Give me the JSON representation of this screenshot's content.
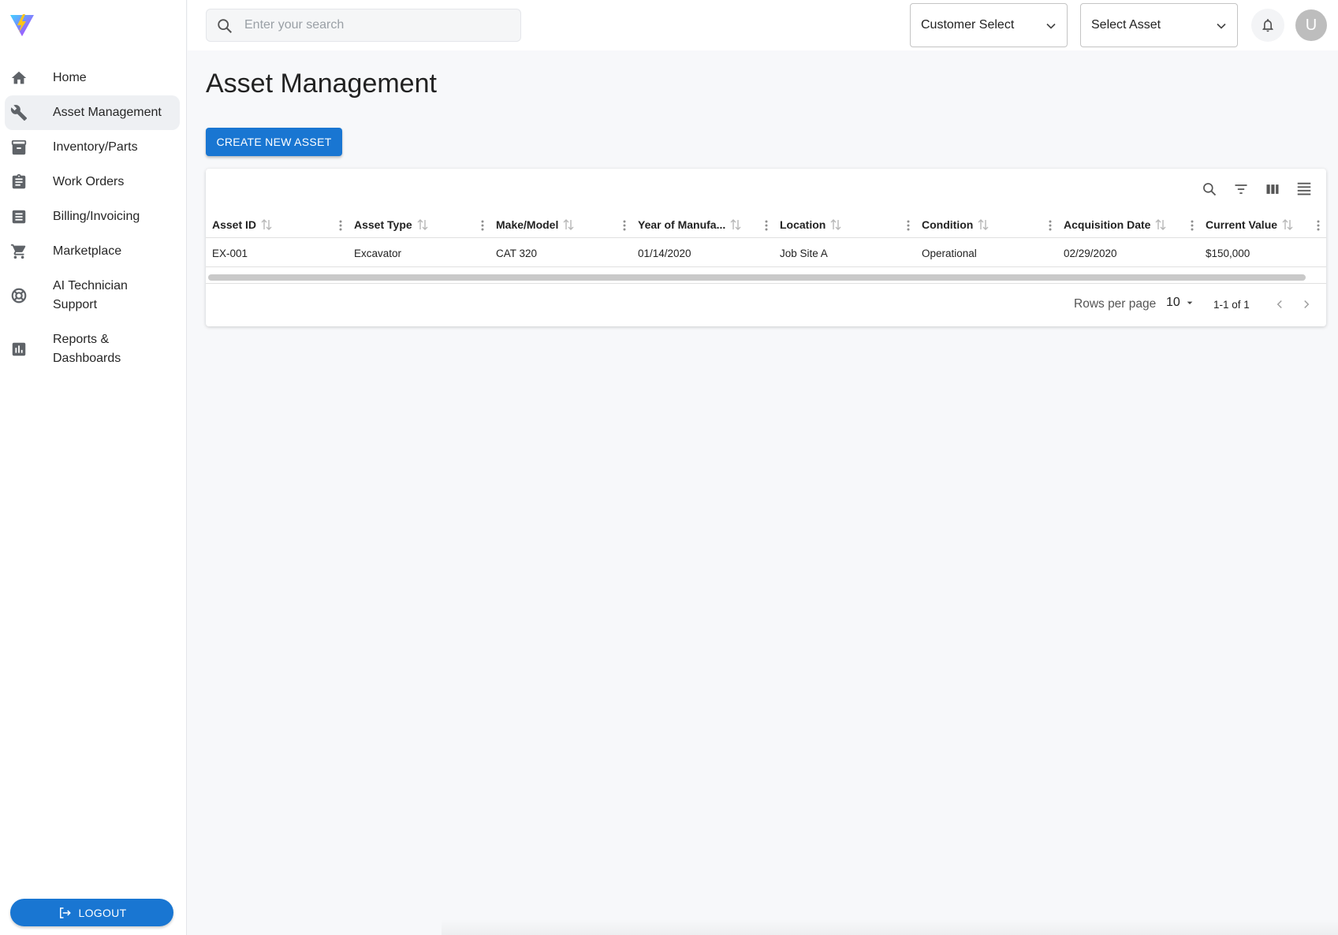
{
  "sidebar": {
    "items": [
      {
        "label": "Home",
        "icon": "home-icon"
      },
      {
        "label": "Asset Management",
        "icon": "wrench-icon",
        "active": true
      },
      {
        "label": "Inventory/Parts",
        "icon": "archive-icon"
      },
      {
        "label": "Work Orders",
        "icon": "clipboard-icon"
      },
      {
        "label": "Billing/Invoicing",
        "icon": "receipt-icon"
      },
      {
        "label": "Marketplace",
        "icon": "cart-icon"
      },
      {
        "label": "AI Technician Support",
        "icon": "lifebuoy-icon"
      },
      {
        "label": "Reports & Dashboards",
        "icon": "bar-chart-icon"
      }
    ],
    "logout_label": "LOGOUT"
  },
  "header": {
    "search_placeholder": "Enter your search",
    "customer_select": "Customer Select",
    "asset_select": "Select Asset",
    "avatar_initial": "U"
  },
  "main": {
    "title": "Asset Management",
    "create_button": "CREATE NEW ASSET"
  },
  "table": {
    "columns": [
      "Asset ID",
      "Asset Type",
      "Make/Model",
      "Year of Manufa...",
      "Location",
      "Condition",
      "Acquisition Date",
      "Current Value"
    ],
    "rows": [
      [
        "EX-001",
        "Excavator",
        "CAT 320",
        "01/14/2020",
        "Job Site A",
        "Operational",
        "02/29/2020",
        "$150,000"
      ]
    ],
    "footer": {
      "rows_per_page_label": "Rows per page",
      "rows_per_page_value": "10",
      "range": "1-1 of 1"
    }
  },
  "colors": {
    "primary": "#1976d2",
    "active_nav_bg": "#eef0f3",
    "page_bg": "#f7f8fa"
  }
}
